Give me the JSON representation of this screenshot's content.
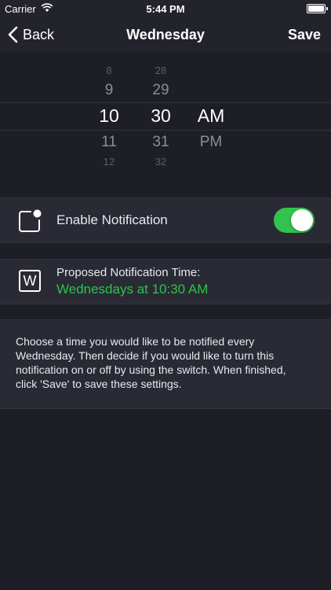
{
  "status_bar": {
    "carrier": "Carrier",
    "time": "5:44 PM"
  },
  "nav": {
    "back_label": "Back",
    "title": "Wednesday",
    "save_label": "Save"
  },
  "picker": {
    "hours": [
      "8",
      "9",
      "10",
      "11",
      "12"
    ],
    "minutes": [
      "28",
      "29",
      "30",
      "31",
      "32"
    ],
    "ampm": [
      "AM",
      "PM"
    ],
    "selected_hour": "10",
    "selected_minute": "30",
    "selected_ampm": "AM"
  },
  "notification": {
    "label": "Enable Notification",
    "enabled": true
  },
  "proposal": {
    "badge": "W",
    "label": "Proposed Notification Time:",
    "value": "Wednesdays at 10:30 AM"
  },
  "info": {
    "text": "Choose a time you would like to be notified every Wednesday. Then decide if you would like to turn this notification on or off by using the switch. When finished, click 'Save' to save these settings."
  },
  "colors": {
    "accent_green": "#33c24d",
    "proposal_text": "#2cc24a",
    "background": "#1e1e27",
    "section": "#2a2a35"
  }
}
